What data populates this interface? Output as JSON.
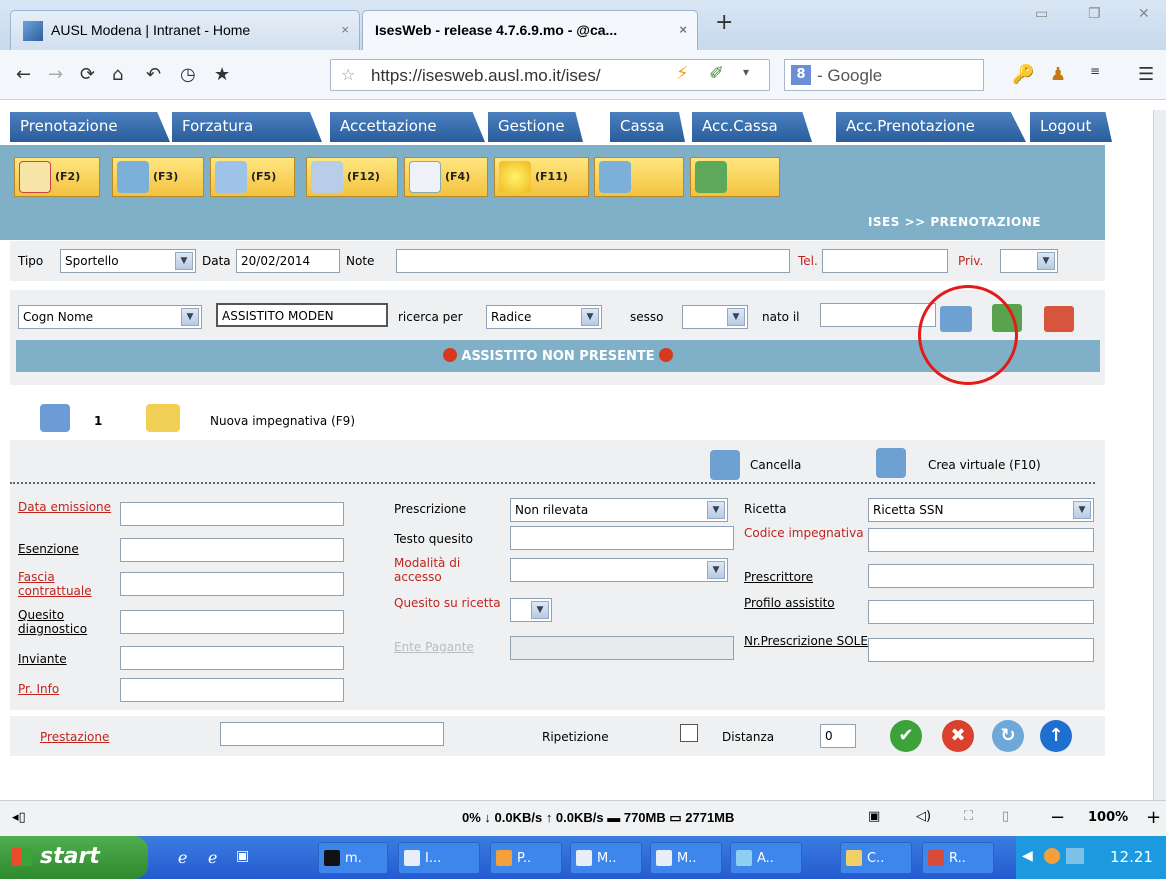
{
  "browser": {
    "tabs": [
      {
        "label": "AUSL Modena | Intranet - Home",
        "close": "×"
      },
      {
        "label": "IsesWeb - release 4.7.6.9.mo - @ca...",
        "close": "×"
      }
    ],
    "new_tab": "+",
    "url": "https://isesweb.ausl.mo.it/ises/",
    "search_engine": "Google",
    "search_placeholder": "- Google"
  },
  "menu": {
    "items": [
      "Prenotazione",
      "Forzatura",
      "Accettazione",
      "Gestione",
      "Cassa",
      "Acc.Cassa",
      "Acc.Prenotazione",
      "Logout"
    ]
  },
  "toolbar": {
    "buttons": [
      "(F2)",
      "(F3)",
      "(F5)",
      "(F12)",
      "(F4)",
      "(F11)",
      "",
      ""
    ],
    "breadcrumb": "ISES >> PRENOTAZIONE"
  },
  "filters": {
    "tipo_label": "Tipo",
    "tipo_value": "Sportello",
    "data_label": "Data",
    "data_value": "20/02/2014",
    "note_label": "Note",
    "note_value": "",
    "tel_label": "Tel.",
    "tel_value": "",
    "priv_label": "Priv.",
    "priv_value": ""
  },
  "search": {
    "field_value": "Cogn Nome",
    "query": "ASSISTITO MODEN",
    "ricerca_label": "ricerca per",
    "ricerca_value": "Radice",
    "sesso_label": "sesso",
    "sesso_value": "",
    "nato_label": "nato il",
    "nato_value": ""
  },
  "banner": "ASSISTITO NON PRESENTE",
  "impegnativa": {
    "count": "1",
    "new_label": "Nuova impegnativa (F9)",
    "cancel_label": "Cancella",
    "virtual_label": "Crea virtuale (F10)"
  },
  "form": {
    "data_emissione": "Data emissione",
    "esenzione": "Esenzione",
    "fascia": "Fascia contrattuale",
    "quesito_diag": "Quesito diagnostico",
    "inviante": "Inviante",
    "pr_info": "Pr. Info",
    "prescrizione_label": "Prescrizione",
    "prescrizione_value": "Non rilevata",
    "testo_quesito": "Testo quesito",
    "modalita": "Modalità di accesso",
    "quesito_ricetta": "Quesito su ricetta",
    "ente_pagante": "Ente Pagante",
    "ricetta_label": "Ricetta",
    "ricetta_value": "Ricetta SSN",
    "codice_imp": "Codice impegnativa",
    "prescrittore": "Prescrittore",
    "profilo": "Profilo assistito",
    "nr_prescr": "Nr.Prescrizione SOLE"
  },
  "prestazione": {
    "label": "Prestazione",
    "value": "",
    "ripetizione": "Ripetizione",
    "distanza": "Distanza",
    "distanza_value": "0"
  },
  "statusbar": {
    "net": "0%  ↓ 0.0KB/s  ↑ 0.0KB/s  ▬ 770MB  ▭ 2771MB",
    "zoom": "100%",
    "minus": "−",
    "plus": "+"
  },
  "taskbar": {
    "start": "start",
    "items": [
      "m.",
      "I...",
      "P..",
      "M..",
      "M..",
      "A..",
      "C..",
      "R.."
    ],
    "clock": "12.21"
  },
  "colors": {
    "menu": "#2a5d9c",
    "header": "#7fb0c8",
    "red": "#c0251c",
    "taskbar": "#245ad0"
  }
}
